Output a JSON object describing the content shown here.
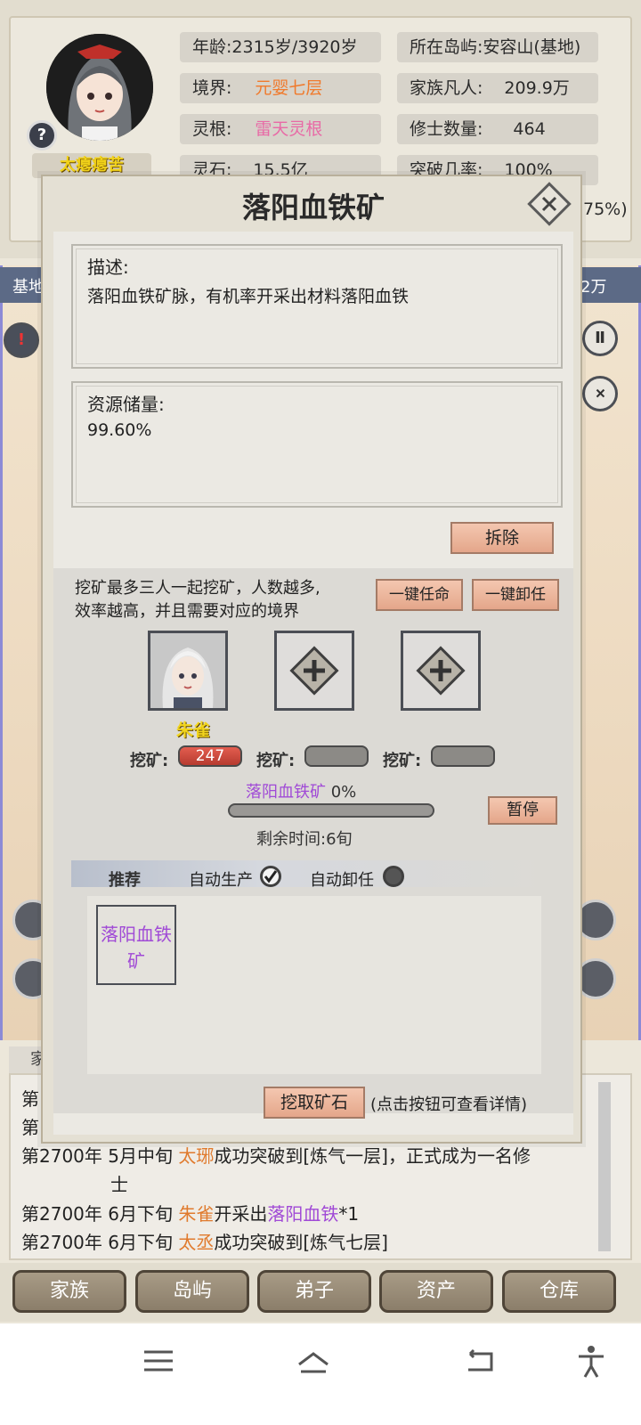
{
  "profile": {
    "name": "太瘪瘪苦",
    "help_icon": "?",
    "stats_left": [
      {
        "label": "年龄:",
        "value": "2315岁/3920岁"
      },
      {
        "label": "境界:",
        "value": "元婴七层"
      },
      {
        "label": "灵根:",
        "value": "雷天灵根"
      },
      {
        "label": "灵石:",
        "value": "15.5亿"
      }
    ],
    "stats_right": [
      {
        "label": "所在岛屿:",
        "value": "安容山(基地)"
      },
      {
        "label": "家族凡人:",
        "value": "209.9万"
      },
      {
        "label": "修士数量:",
        "value": "464"
      },
      {
        "label": "突破几率:",
        "value": "100%"
      }
    ],
    "partial_pct": "75%)"
  },
  "background": {
    "strip_left": "基地",
    "strip_right": "2万",
    "log_tab": "家",
    "log_prefix_a": "第",
    "log_prefix_b": "第"
  },
  "modal": {
    "title": "落阳血铁矿",
    "desc_label": "描述:",
    "desc_text": "落阳血铁矿脉，有机率开采出材料落阳血铁",
    "reserve_label": "资源储量:",
    "reserve_value": "99.60%",
    "demolish_btn": "拆除",
    "mining_desc_1": "挖矿最多三人一起挖矿，人数越多,",
    "mining_desc_2": "效率越高，并且需要对应的境界",
    "assign_all_btn": "一键任命",
    "dismiss_all_btn": "一键卸任",
    "worker_name": "朱雀",
    "mine_label": "挖矿:",
    "worker_values": [
      "247",
      "",
      ""
    ],
    "product_name": "落阳血铁矿",
    "product_pct": "0%",
    "product_progress": 0,
    "pause_btn": "暂停",
    "remaining_time": "剩余时间:6旬",
    "tab_recommend": "推荐",
    "auto_produce_label": "自动生产",
    "auto_produce_on": true,
    "auto_dismiss_label": "自动卸任",
    "auto_dismiss_on": false,
    "recommend_item": "落阳血铁矿",
    "dig_btn": "挖取矿石",
    "dig_hint": "(点击按钮可查看详情)"
  },
  "log": [
    {
      "date": "第2700年",
      "time": "5月中旬",
      "actor": "太琊",
      "text": "成功突破到[炼气一层]，正式成为一名修",
      "cont": "士"
    },
    {
      "date": "第2700年",
      "time": "6月下旬",
      "actor": "朱雀",
      "text": "开采出",
      "item": "落阳血铁",
      "suffix": "*1"
    },
    {
      "date": "第2700年",
      "time": "6月下旬",
      "actor": "太丞",
      "text": "成功突破到[炼气七层]"
    }
  ],
  "nav": [
    "家族",
    "岛屿",
    "弟子",
    "资产",
    "仓库"
  ],
  "colors": {
    "orange": "#f07a2c",
    "pink": "#e86aa6",
    "purple": "#a04ad6",
    "yellow": "#f2d51c"
  }
}
